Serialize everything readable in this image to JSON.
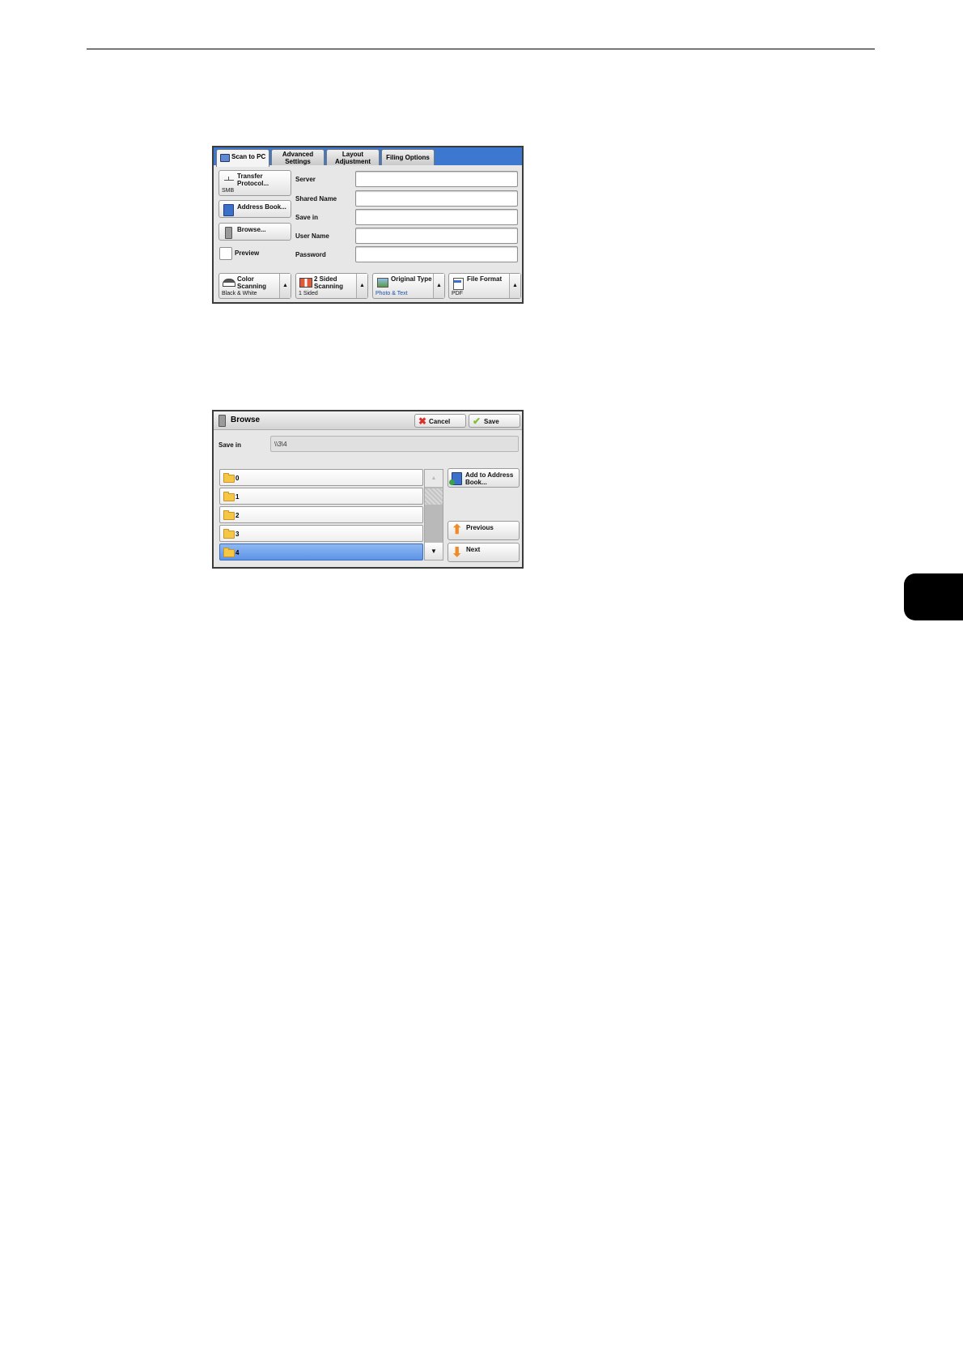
{
  "panel1": {
    "tabs": [
      {
        "label": "Scan to PC"
      },
      {
        "label": "Advanced Settings"
      },
      {
        "label": "Layout Adjustment"
      },
      {
        "label": "Filing Options"
      }
    ],
    "transfer_protocol": {
      "label": "Transfer Protocol...",
      "value": "SMB"
    },
    "address_book_label": "Address Book...",
    "browse_label": "Browse...",
    "preview_label": "Preview",
    "fields": [
      {
        "label": "Server",
        "value": ""
      },
      {
        "label": "Shared Name",
        "value": ""
      },
      {
        "label": "Save in",
        "value": ""
      },
      {
        "label": "User Name",
        "value": ""
      },
      {
        "label": "Password",
        "value": ""
      }
    ],
    "bottom_buttons": [
      {
        "label": "Color Scanning",
        "value": "Black & White"
      },
      {
        "label": "2 Sided Scanning",
        "value": "1 Sided"
      },
      {
        "label": "Original Type",
        "value": "Photo & Text"
      },
      {
        "label": "File Format",
        "value": "PDF"
      }
    ]
  },
  "panel2": {
    "title": "Browse",
    "cancel_label": "Cancel",
    "save_label": "Save",
    "save_in_label": "Save in",
    "save_in_value": "\\\\3\\4",
    "folders": [
      "0",
      "1",
      "2",
      "3",
      "4"
    ],
    "selected_index": 4,
    "add_to_address_book_label": "Add to Address Book...",
    "previous_label": "Previous",
    "next_label": "Next"
  },
  "colors": {
    "tab_bar": "#3c78d0",
    "selected_row": "#5d93e6",
    "cancel_icon": "#d9302a",
    "save_icon": "#7fbf3a",
    "arrow_icon": "#f08a24"
  }
}
